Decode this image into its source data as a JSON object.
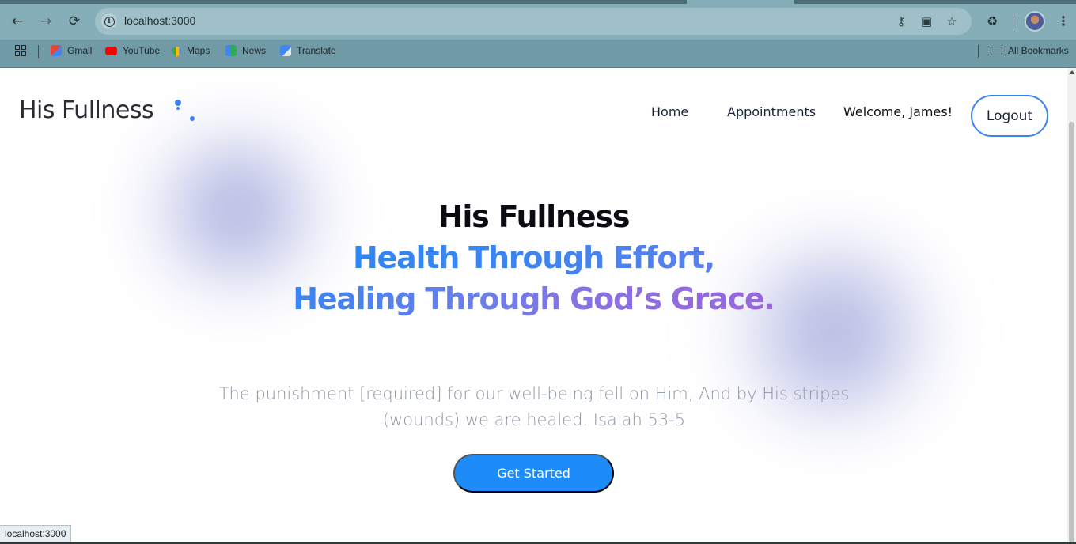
{
  "browser": {
    "url": "localhost:3000",
    "status_url": "localhost:3000",
    "bookmarks": [
      {
        "label": "Gmail",
        "color": "#ea4335"
      },
      {
        "label": "YouTube",
        "color": "#ff0000"
      },
      {
        "label": "Maps",
        "color": "#34a853"
      },
      {
        "label": "News",
        "color": "#4285f4"
      },
      {
        "label": "Translate",
        "color": "#4285f4"
      }
    ],
    "all_bookmarks_label": "All Bookmarks"
  },
  "site": {
    "logo": "His Fullness",
    "nav": {
      "home": "Home",
      "appointments": "Appointments",
      "welcome": "Welcome, James!",
      "logout": "Logout"
    },
    "hero": {
      "line1": "His Fullness",
      "line2": "Health Through Effort,",
      "line3": "Healing Through God’s Grace.",
      "verse": "The punishment [required] for our well-being fell on Him, And by His stripes (wounds) we are healed. Isaiah 53-5",
      "cta": "Get Started"
    },
    "colors": {
      "accent": "#3b82f6",
      "cta": "#1d8cf8",
      "gradient_purple": "#9a66dc"
    }
  }
}
